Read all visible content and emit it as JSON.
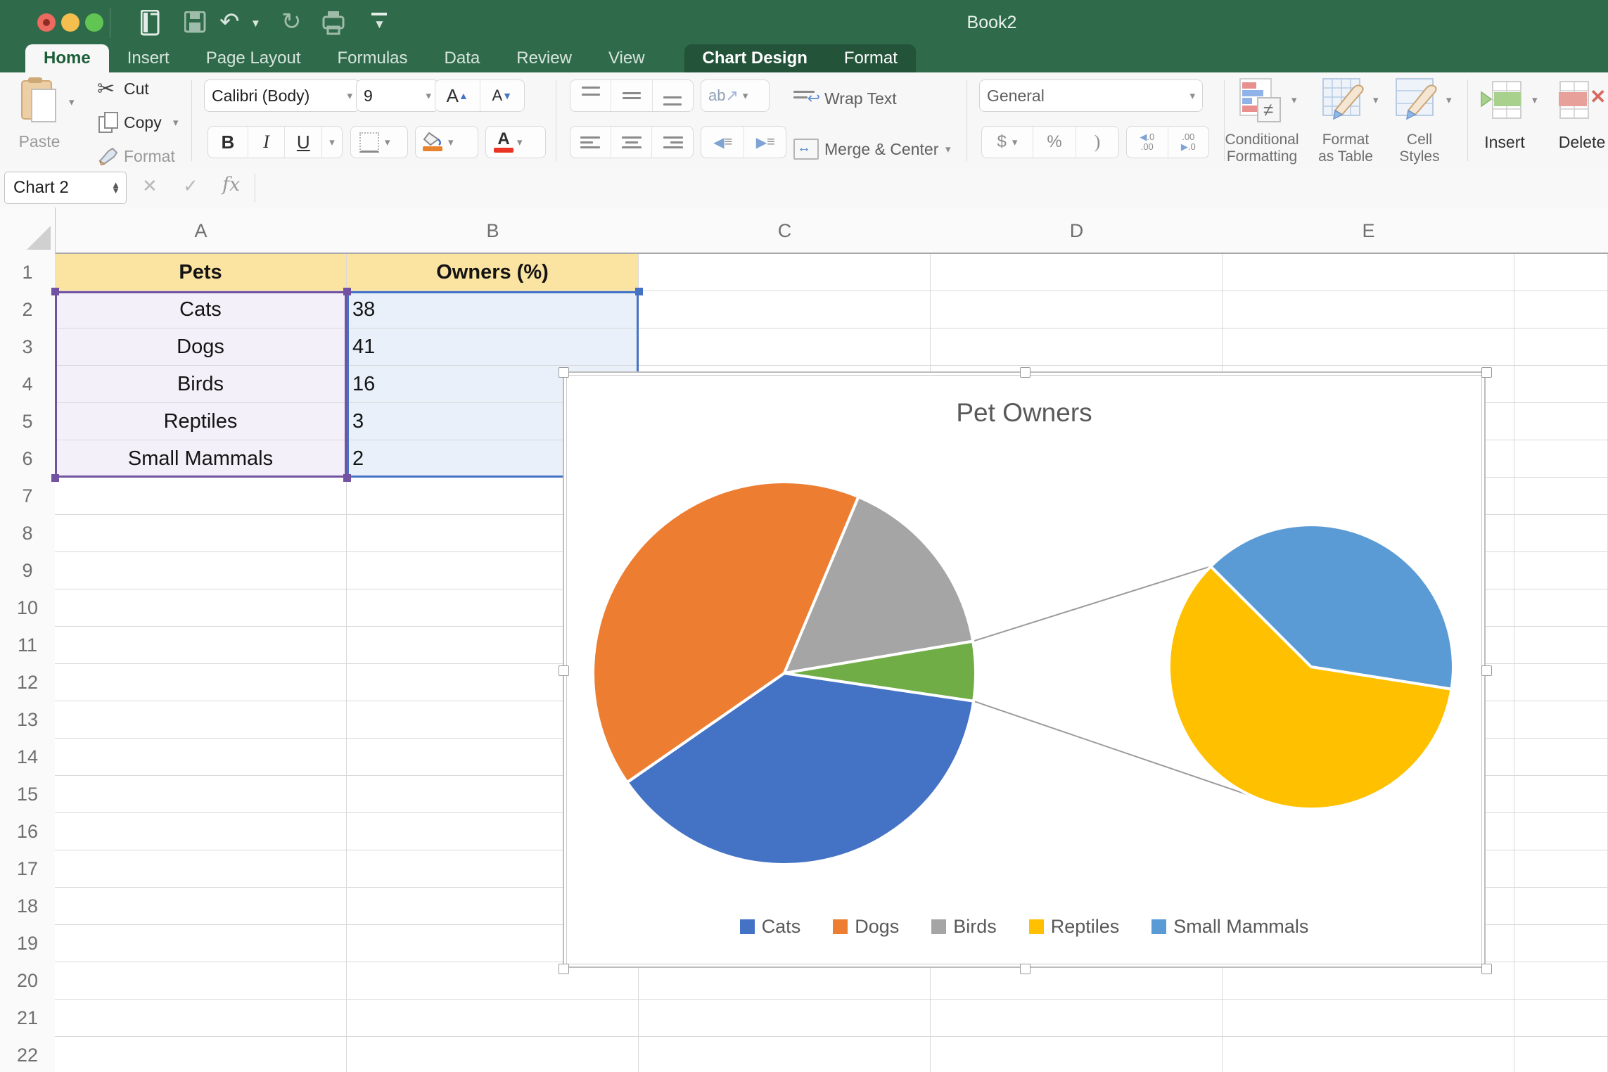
{
  "window": {
    "title": "Book2"
  },
  "quick_access": {
    "icons": [
      "new-workbook",
      "save",
      "undo",
      "undo-menu",
      "redo",
      "print",
      "customize-toolbar"
    ]
  },
  "tabs": {
    "items": [
      {
        "label": "Home",
        "active": true,
        "contextual": false
      },
      {
        "label": "Insert",
        "active": false,
        "contextual": false
      },
      {
        "label": "Page Layout",
        "active": false,
        "contextual": false
      },
      {
        "label": "Formulas",
        "active": false,
        "contextual": false
      },
      {
        "label": "Data",
        "active": false,
        "contextual": false
      },
      {
        "label": "Review",
        "active": false,
        "contextual": false
      },
      {
        "label": "View",
        "active": false,
        "contextual": false
      },
      {
        "label": "Chart Design",
        "active": false,
        "contextual": true
      },
      {
        "label": "Format",
        "active": false,
        "contextual": true
      }
    ]
  },
  "ribbon": {
    "clipboard": {
      "paste": "Paste",
      "cut": "Cut",
      "copy": "Copy",
      "format": "Format"
    },
    "font": {
      "name": "Calibri (Body)",
      "size": "9",
      "bold": "B",
      "italic": "I",
      "underline": "U"
    },
    "alignment": {
      "wrap_text": "Wrap Text",
      "merge_center": "Merge & Center",
      "orientation": "ab"
    },
    "number": {
      "format": "General",
      "currency": "$",
      "percent": "%",
      "comma": ")"
    },
    "styles": {
      "conditional_line1": "Conditional",
      "conditional_line2": "Formatting",
      "format_table_line1": "Format",
      "format_table_line2": "as Table",
      "cell_styles_line1": "Cell",
      "cell_styles_line2": "Styles"
    },
    "cells": {
      "insert": "Insert",
      "delete": "Delete"
    }
  },
  "formula_bar": {
    "name_box": "Chart 2",
    "fx": "fx",
    "cancel": "✕",
    "enter": "✓"
  },
  "grid": {
    "columns": [
      "A",
      "B",
      "C",
      "D",
      "E"
    ],
    "row_count": 22,
    "header_row": {
      "a": "Pets",
      "b": "Owners (%)"
    },
    "rows": [
      {
        "pet": "Cats",
        "value": "38"
      },
      {
        "pet": "Dogs",
        "value": "41"
      },
      {
        "pet": "Birds",
        "value": "16"
      },
      {
        "pet": "Reptiles",
        "value": "3"
      },
      {
        "pet": "Small Mammals",
        "value": "2"
      }
    ]
  },
  "chart_data": {
    "type": "pie",
    "subtype": "pie-of-pie",
    "title": "Pet Owners",
    "categories": [
      "Cats",
      "Dogs",
      "Birds",
      "Reptiles",
      "Small Mammals"
    ],
    "values": [
      38,
      41,
      16,
      3,
      2
    ],
    "secondary_pie": {
      "categories": [
        "Reptiles",
        "Small Mammals"
      ],
      "values": [
        3,
        2
      ],
      "other_slice_value": 5
    },
    "legend_position": "bottom",
    "colors": {
      "Cats": "#4472C4",
      "Dogs": "#ED7D31",
      "Birds": "#A5A5A5",
      "Reptiles": "#FFC000",
      "Small Mammals": "#5B9BD5",
      "Other": "#70AD47"
    }
  },
  "colors": {
    "titlebar_green": "#2F6B4B",
    "contextual_tab_green": "#235339",
    "active_tab_text": "#1B5E38",
    "range_purple": "#7252A1",
    "range_purple_fill": "#F4F0F9",
    "range_blue": "#4472C4",
    "range_blue_fill": "#E9F0F9",
    "header_fill_yellow": "#FBE3A2",
    "traffic_red": "#ED6A5E",
    "traffic_yellow": "#F5BF4F",
    "traffic_green": "#61C554",
    "fill_swatch_orange": "#E8822D",
    "font_swatch_red": "#EA3323",
    "chart_text_gray": "#595959"
  }
}
